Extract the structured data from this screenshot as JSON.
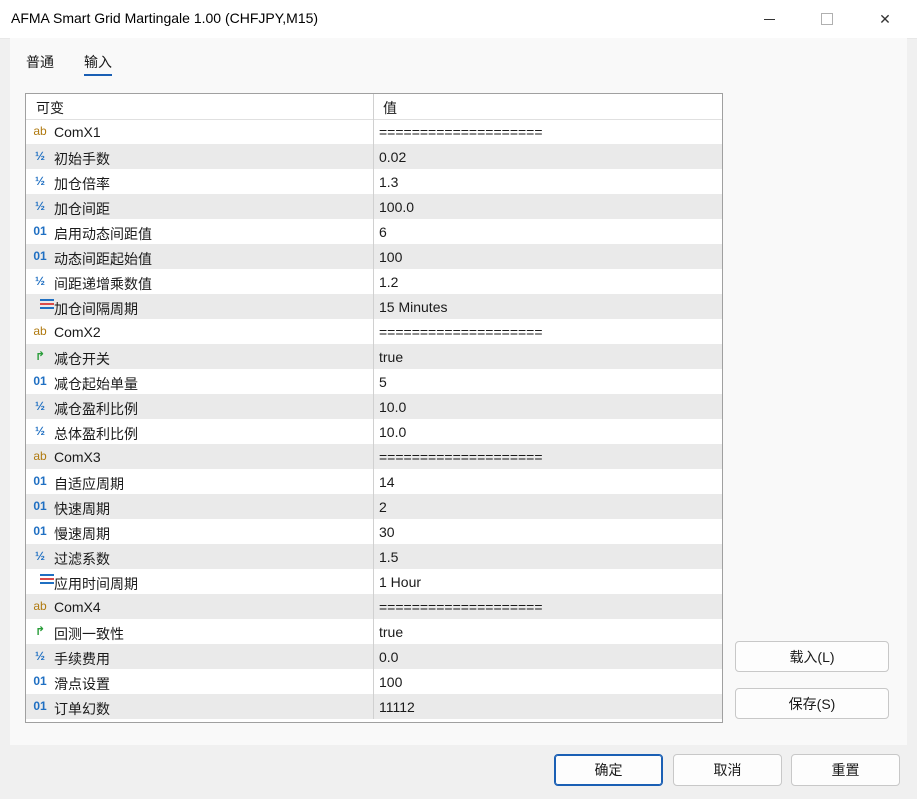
{
  "window": {
    "title": "AFMA Smart Grid Martingale 1.00 (CHFJPY,M15)",
    "minimize_glyph": "",
    "maximize_glyph": "",
    "close_glyph": "✕"
  },
  "tabs": [
    {
      "label": "普通",
      "active": false
    },
    {
      "label": "输入",
      "active": true
    }
  ],
  "grid": {
    "headers": {
      "variable": "可变",
      "value": "值"
    },
    "rows": [
      {
        "icon": "string-icon",
        "glyph": "ab",
        "name": "ComX1",
        "value": "===================="
      },
      {
        "icon": "double-icon",
        "glyph": "½",
        "name": "初始手数",
        "value": "0.02"
      },
      {
        "icon": "double-icon",
        "glyph": "½",
        "name": "加仓倍率",
        "value": "1.3"
      },
      {
        "icon": "double-icon",
        "glyph": "½",
        "name": "加仓间距",
        "value": "100.0"
      },
      {
        "icon": "integer-icon",
        "glyph": "01",
        "name": "启用动态间距值",
        "value": "6"
      },
      {
        "icon": "integer-icon",
        "glyph": "01",
        "name": "动态间距起始值",
        "value": "100"
      },
      {
        "icon": "double-icon",
        "glyph": "½",
        "name": "间距递增乘数值",
        "value": "1.2"
      },
      {
        "icon": "enum-icon",
        "glyph": "",
        "name": "加仓间隔周期",
        "value": "15 Minutes"
      },
      {
        "icon": "string-icon",
        "glyph": "ab",
        "name": "ComX2",
        "value": "===================="
      },
      {
        "icon": "bool-icon",
        "glyph": "↱",
        "name": "减仓开关",
        "value": "true"
      },
      {
        "icon": "integer-icon",
        "glyph": "01",
        "name": "减仓起始单量",
        "value": "5"
      },
      {
        "icon": "double-icon",
        "glyph": "½",
        "name": "减仓盈利比例",
        "value": "10.0"
      },
      {
        "icon": "double-icon",
        "glyph": "½",
        "name": "总体盈利比例",
        "value": "10.0"
      },
      {
        "icon": "string-icon",
        "glyph": "ab",
        "name": "ComX3",
        "value": "===================="
      },
      {
        "icon": "integer-icon",
        "glyph": "01",
        "name": "自适应周期",
        "value": "14"
      },
      {
        "icon": "integer-icon",
        "glyph": "01",
        "name": "快速周期",
        "value": "2"
      },
      {
        "icon": "integer-icon",
        "glyph": "01",
        "name": "慢速周期",
        "value": "30"
      },
      {
        "icon": "double-icon",
        "glyph": "½",
        "name": "过滤系数",
        "value": "1.5"
      },
      {
        "icon": "enum-icon",
        "glyph": "",
        "name": "应用时间周期",
        "value": "1 Hour"
      },
      {
        "icon": "string-icon",
        "glyph": "ab",
        "name": "ComX4",
        "value": "===================="
      },
      {
        "icon": "bool-icon",
        "glyph": "↱",
        "name": "回测一致性",
        "value": "true"
      },
      {
        "icon": "double-icon",
        "glyph": "½",
        "name": "手续费用",
        "value": "0.0"
      },
      {
        "icon": "integer-icon",
        "glyph": "01",
        "name": "滑点设置",
        "value": "100"
      },
      {
        "icon": "integer-icon",
        "glyph": "01",
        "name": "订单幻数",
        "value": "11112"
      }
    ]
  },
  "side_buttons": {
    "load": "载入(L)",
    "save": "保存(S)"
  },
  "bottom_buttons": {
    "ok": "确定",
    "cancel": "取消",
    "reset": "重置"
  }
}
